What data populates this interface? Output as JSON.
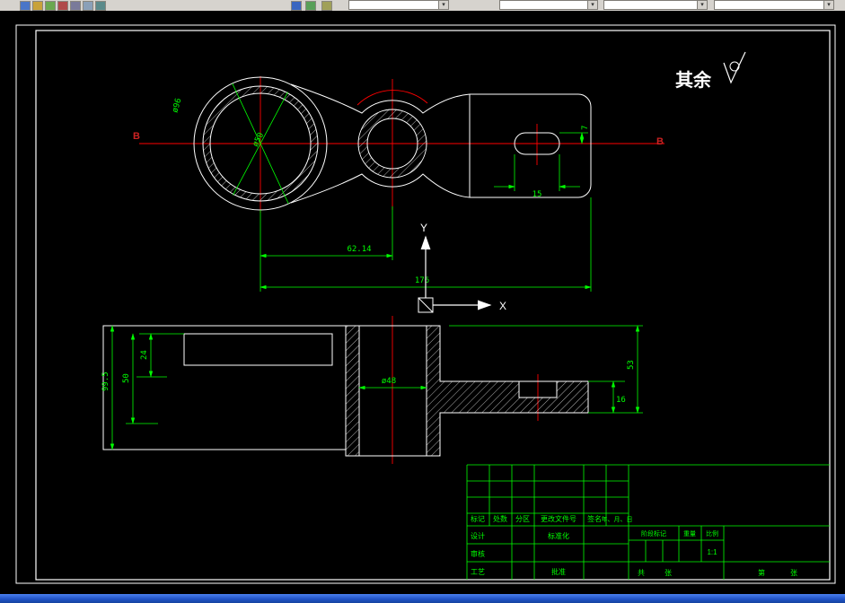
{
  "colors": {
    "outline": "#ffffff",
    "dimension": "#00ff00",
    "centerline": "#ff0000",
    "section_label": "#cc2222",
    "canvas_bg": "#000000",
    "toolbar_bg": "#d6d3ce",
    "taskbar_bg": "#2456cf"
  },
  "annotations": {
    "surface_note": "其余",
    "section_label_left": "B",
    "section_label_right": "B",
    "ucs_axis_x": "X",
    "ucs_axis_y": "Y"
  },
  "dimensions": {
    "center_distance": "62.14",
    "overall_length": "176",
    "slot_length": "15",
    "slot_offset": "7",
    "bore_label": "ø50",
    "boss_label": "ø96",
    "section_total_depth": "99.5",
    "section_bore_depth": "50",
    "section_step_depth": "24",
    "section_mid_bore": "ø48",
    "section_flange_thickness": "16",
    "section_right_height": "53"
  },
  "title_block": {
    "rev_headers": [
      "标记",
      "处数",
      "分区",
      "更改文件号",
      "签名",
      "年、月、日"
    ],
    "roles": {
      "design": "设计",
      "standardization": "标准化",
      "check": "审核",
      "process": "工艺",
      "approve": "批准"
    },
    "fields": {
      "stage_mark": "阶段标记",
      "weight": "重量",
      "scale": "比例",
      "scale_value": "1:1",
      "sheet_total_prefix": "共",
      "sheet_total_suffix": "张",
      "sheet_index_prefix": "第",
      "sheet_index_suffix": "张"
    }
  }
}
